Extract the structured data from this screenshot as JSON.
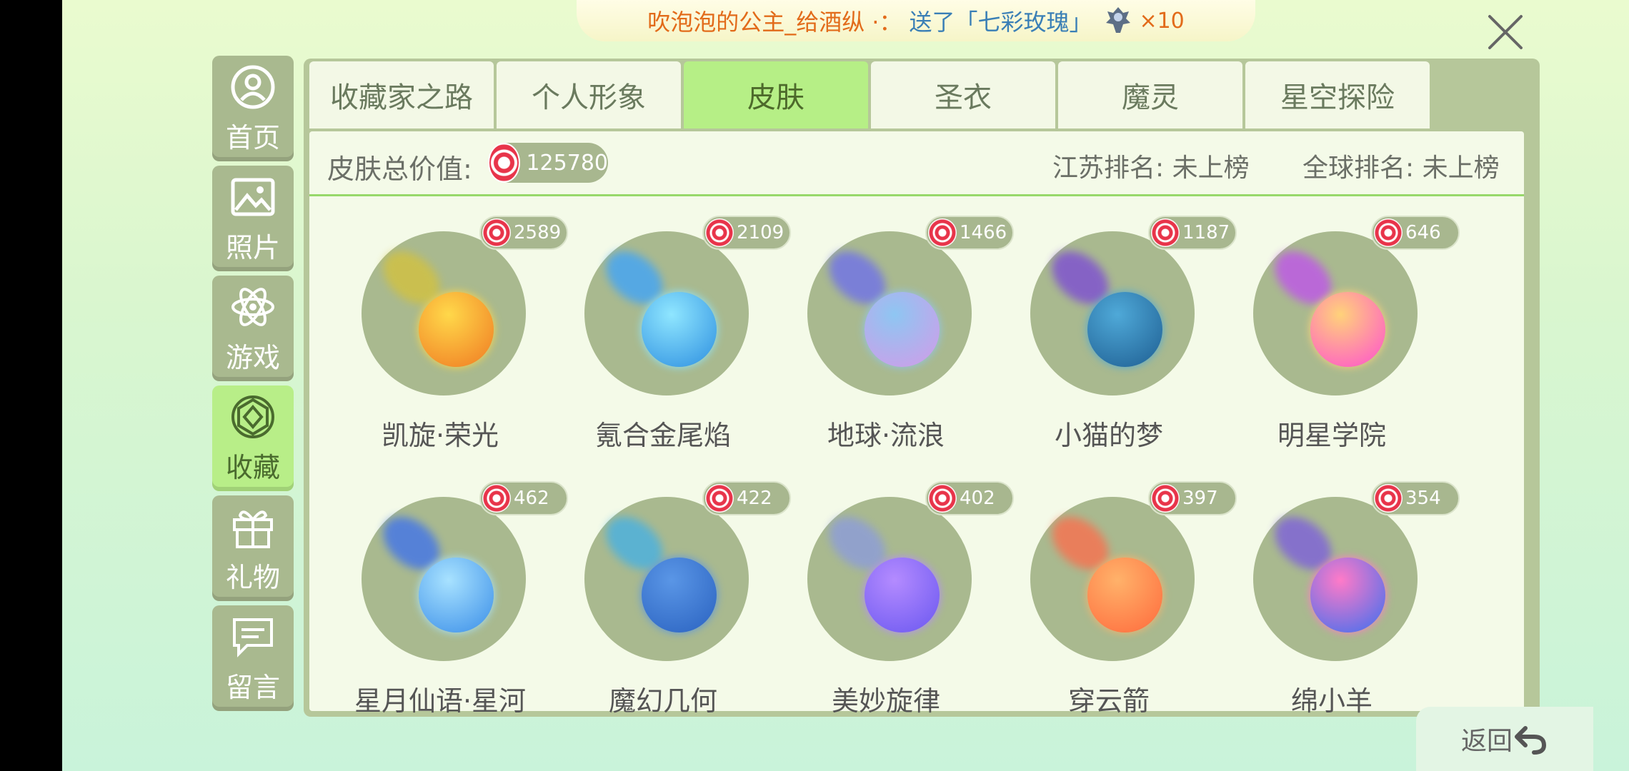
{
  "banner": {
    "sender": "吹泡泡的公主_给酒纵",
    "separator": "·：",
    "message": "送了「七彩玫瑰」",
    "count": "×10"
  },
  "sidebar": {
    "items": [
      {
        "label": "首页",
        "icon": "user-circle-icon"
      },
      {
        "label": "照片",
        "icon": "photo-icon"
      },
      {
        "label": "游戏",
        "icon": "atom-icon"
      },
      {
        "label": "收藏",
        "icon": "gem-icon",
        "active": true
      },
      {
        "label": "礼物",
        "icon": "gift-icon"
      },
      {
        "label": "留言",
        "icon": "message-icon"
      }
    ]
  },
  "tabs": [
    {
      "label": "收藏家之路"
    },
    {
      "label": "个人形象"
    },
    {
      "label": "皮肤",
      "active": true
    },
    {
      "label": "圣衣"
    },
    {
      "label": "魔灵"
    },
    {
      "label": "星空探险"
    }
  ],
  "summary": {
    "label": "皮肤总价值:",
    "total": "125780",
    "rank_local": "江苏排名: 未上榜",
    "rank_global": "全球排名: 未上榜"
  },
  "skins": [
    {
      "name": "凯旋·荣光",
      "value": "2589",
      "ball": "#f07a22",
      "ball2": "#ffd84a",
      "trail": "#d5c23a"
    },
    {
      "name": "氪合金尾焰",
      "value": "2109",
      "ball": "#2d8fe0",
      "ball2": "#8fe6ff",
      "trail": "#3aa3ff"
    },
    {
      "name": "地球·流浪",
      "value": "1466",
      "ball": "#d39be8",
      "ball2": "#8ec6f2",
      "trail": "#6b6cf0"
    },
    {
      "name": "小猫的梦",
      "value": "1187",
      "ball": "#1e5e92",
      "ball2": "#4fa9d8",
      "trail": "#7a46d8"
    },
    {
      "name": "明星学院",
      "value": "646",
      "ball": "#ff4fd0",
      "ball2": "#ffd27a",
      "trail": "#c04ef0"
    },
    {
      "name": "星月仙语·星河",
      "value": "462",
      "ball": "#3a8ee8",
      "ball2": "#a8e2ff",
      "trail": "#3a6ff0"
    },
    {
      "name": "魔幻几何",
      "value": "422",
      "ball": "#2a62c0",
      "ball2": "#5a96e6",
      "trail": "#41b0e8"
    },
    {
      "name": "美妙旋律",
      "value": "402",
      "ball": "#6a57f0",
      "ball2": "#b48bff",
      "trail": "#8a9ae0"
    },
    {
      "name": "穿云箭",
      "value": "397",
      "ball": "#ff6a3c",
      "ball2": "#ffb26a",
      "trail": "#ff6b4a"
    },
    {
      "name": "绵小羊",
      "value": "354",
      "ball": "#3a6ff0",
      "ball2": "#ff7ac8",
      "trail": "#7a5ae0"
    }
  ],
  "back_label": "返回",
  "colors": {
    "sidebar_active": "#b8ee88",
    "tab_active": "#b6ef86",
    "panel": "#b6c79a",
    "candy_red": "#e8344a"
  }
}
